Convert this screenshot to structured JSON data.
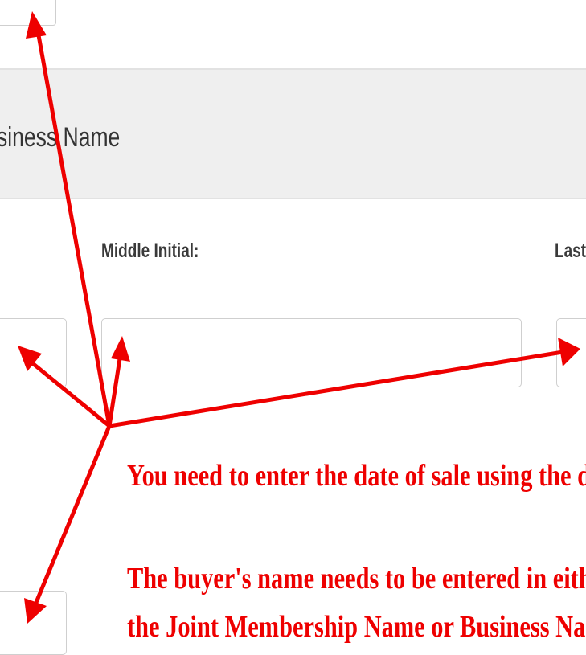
{
  "section": {
    "title_fragment": "siness Name"
  },
  "fields": {
    "middle_initial_label": "Middle Initial:",
    "last_name_label_fragment": "Last",
    "first_name_value": "",
    "middle_initial_value": "",
    "last_name_value": ""
  },
  "annotations": {
    "line1": "You need to enter the date of sale using the da",
    "line2": "The buyer's name needs to be entered in either",
    "line3": "the Joint Membership Name or Business Nam"
  },
  "colors": {
    "annotation": "#ee0000",
    "section_background": "#efefef"
  },
  "icons": {
    "top_button_icon": "calendar-icon"
  }
}
